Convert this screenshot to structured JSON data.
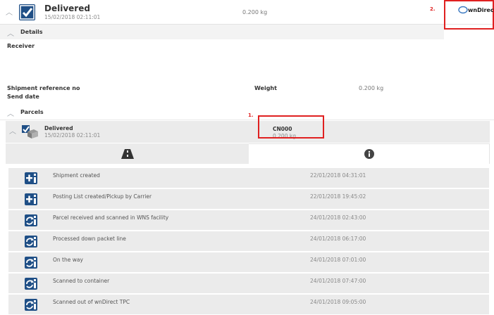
{
  "header": {
    "status": "Delivered",
    "datetime": "15/02/2018 02:11:01",
    "weight": "0.200 kg",
    "annotation_2": "2.",
    "logo_text": "wnDirect"
  },
  "details": {
    "section_label": "Details",
    "receiver_label": "Receiver",
    "shipment_ref_label": "Shipment reference no",
    "weight_label": "Weight",
    "weight_value": "0.200 kg",
    "send_date_label": "Send date"
  },
  "parcels": {
    "section_label": "Parcels",
    "annotation_1": "1.",
    "parcel": {
      "status": "Delivered",
      "datetime": "15/02/2018 02:11:01",
      "tracking_id": "CN000",
      "weight": "0.200 kg"
    }
  },
  "events": [
    {
      "label": "Shipment created",
      "datetime": "22/01/2018 04:31:01",
      "icon": "plus-document-icon"
    },
    {
      "label": "Posting List created/Pickup by Carrier",
      "datetime": "22/01/2018 19:45:02",
      "icon": "plus-document-icon"
    },
    {
      "label": "Parcel received and scanned in WNS facility",
      "datetime": "24/01/2018 02:43:00",
      "icon": "refresh-document-icon"
    },
    {
      "label": "Processed down packet line",
      "datetime": "24/01/2018 06:17:00",
      "icon": "refresh-document-icon"
    },
    {
      "label": "On the way",
      "datetime": "24/01/2018 07:01:00",
      "icon": "refresh-document-icon"
    },
    {
      "label": "Scanned to container",
      "datetime": "24/01/2018 07:47:00",
      "icon": "refresh-document-icon"
    },
    {
      "label": "Scanned out of wnDirect TPC",
      "datetime": "24/01/2018 09:05:00",
      "icon": "refresh-document-icon"
    }
  ],
  "colors": {
    "icon_blue": "#1f4f86",
    "highlight_red": "#e02020",
    "row_gray": "#ebebeb"
  }
}
